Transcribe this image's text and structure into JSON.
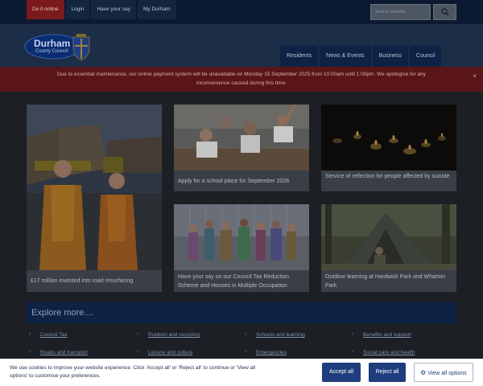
{
  "topbar": {
    "links": [
      "Do it online",
      "Login",
      "Have your say",
      "My Durham"
    ],
    "search_placeholder": "Search website"
  },
  "header": {
    "logo_title": "Durham",
    "logo_subtitle": "County Council",
    "nav": [
      "Residents",
      "News & Events",
      "Business",
      "Council"
    ]
  },
  "banner": {
    "text": "Due to essential maintenance, our online payment system will be unavailable on Monday 15 September 2025 from 10:00am until 1:00pm. We apologise for any inconvenience caused during this time.",
    "close": "×"
  },
  "cards": [
    {
      "caption": "£17 million invested into road resurfacing",
      "image": "road-workers-photo"
    },
    {
      "caption": "Apply for a school place for September 2026",
      "image": "classroom-photo"
    },
    {
      "caption": "Service of reflection for people affected by suicide",
      "image": "candles-photo"
    },
    {
      "caption": "Have your say on our Council Tax Reduction Scheme and Houses in Multiple Occupation",
      "image": "people-illustration"
    },
    {
      "caption": "Outdoor learning at Hardwick Park and Wharton Park",
      "image": "woodland-shelter-photo"
    }
  ],
  "explore": {
    "heading": "Explore more....",
    "links": [
      "Council Tax",
      "Rubbish and recycling",
      "Schools and learning",
      "Benefits and support",
      "Roads and transport",
      "Leisure and culture",
      "Emergencies",
      "Social care and health"
    ]
  },
  "cookie": {
    "text": "We use cookies to improve your website experience. Click 'Accept all' or 'Reject all' to continue or 'View all options' to customise your preferences.",
    "accept": "Accept all",
    "reject": "Reject all",
    "options": "View all options"
  },
  "colors": {
    "navy": "#0d2244",
    "banner_red": "#5a1518",
    "accept_blue": "#1d3d7c"
  }
}
